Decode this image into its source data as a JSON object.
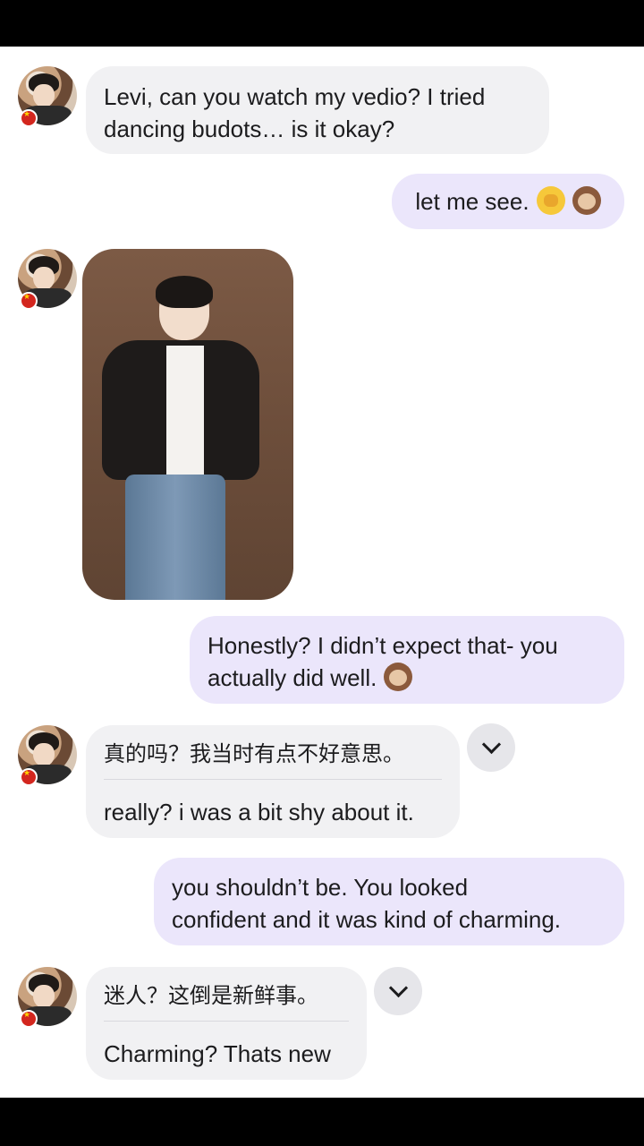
{
  "messages": [
    {
      "sender": "contact",
      "text": "Levi, can you watch my vedio? I tried dancing budots… is it okay?"
    },
    {
      "sender": "me",
      "text": "let me see.",
      "emojis": [
        "face-with-hand-over-mouth",
        "see-no-evil-monkey"
      ]
    },
    {
      "sender": "contact",
      "type": "image",
      "image_desc": "man-in-black-leather-jacket-and-jeans"
    },
    {
      "sender": "me",
      "text_line1": "Honestly? I didn’t expect that- you",
      "text_line2": "actually did well.",
      "emojis": [
        "see-no-evil-monkey"
      ]
    },
    {
      "sender": "contact",
      "original": "真的吗？我当时有点不好意思。",
      "translation": "really? i was a bit shy about it."
    },
    {
      "sender": "me",
      "text_line1": "you shouldn’t be. You looked",
      "text_line2": "confident and it was kind of charming."
    },
    {
      "sender": "contact",
      "original": "迷人？这倒是新鲜事。",
      "translation": "Charming? Thats new"
    }
  ],
  "colors": {
    "incoming_bubble": "#f1f1f3",
    "outgoing_bubble": "#ebe6fb",
    "status_bar": "#000000"
  }
}
